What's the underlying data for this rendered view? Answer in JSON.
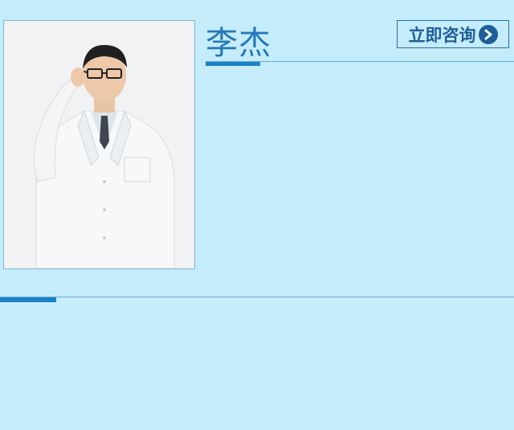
{
  "profile": {
    "name": "李杰",
    "photo_alt": "doctor-portrait"
  },
  "actions": {
    "consult_label": "立即咨询",
    "consult_icon": "chevron-right-circle-icon"
  },
  "colors": {
    "background": "#c4ecfb",
    "accent": "#1b82c6",
    "name_text": "#2377b8",
    "button_text": "#1f5e96"
  }
}
